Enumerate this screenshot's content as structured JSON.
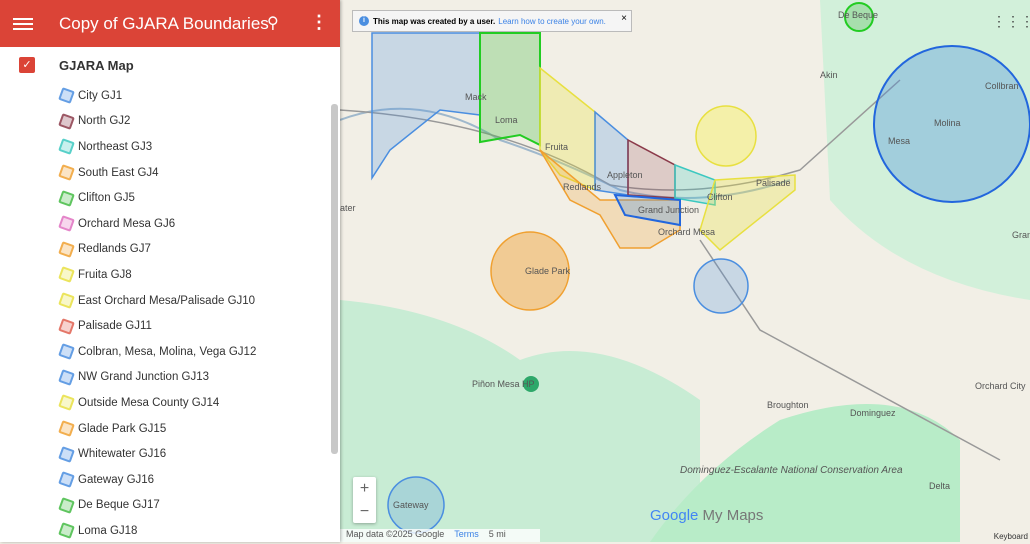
{
  "header": {
    "title": "Copy of GJARA Boundaries",
    "menu_icon": "hamburger-icon",
    "search_icon": "search-icon",
    "more_icon": "more-vert-icon"
  },
  "layer": {
    "name": "GJARA Map",
    "checked": true
  },
  "items": [
    {
      "label": "City GJ1",
      "color": "#4a8ee0"
    },
    {
      "label": "North GJ2",
      "color": "#8b3a4a"
    },
    {
      "label": "Northeast GJ3",
      "color": "#3cc8c0"
    },
    {
      "label": "South East GJ4",
      "color": "#f0a030"
    },
    {
      "label": "Clifton GJ5",
      "color": "#44bb44"
    },
    {
      "label": "Orchard Mesa GJ6",
      "color": "#e070c0"
    },
    {
      "label": "Redlands GJ7",
      "color": "#f0a030"
    },
    {
      "label": "Fruita GJ8",
      "color": "#e8e040"
    },
    {
      "label": "East Orchard Mesa/Palisade GJ10",
      "color": "#e8e040"
    },
    {
      "label": "Palisade GJ11",
      "color": "#e06050"
    },
    {
      "label": "Colbran, Mesa, Molina, Vega GJ12",
      "color": "#4a8ee0"
    },
    {
      "label": "NW Grand Junction GJ13",
      "color": "#4a8ee0"
    },
    {
      "label": "Outside Mesa County GJ14",
      "color": "#e8e040"
    },
    {
      "label": "Glade Park GJ15",
      "color": "#f0a030"
    },
    {
      "label": "Whitewater GJ16",
      "color": "#4a8ee0"
    },
    {
      "label": "Gateway GJ16",
      "color": "#4a8ee0"
    },
    {
      "label": "De Beque GJ17",
      "color": "#44bb44"
    },
    {
      "label": "Loma GJ18",
      "color": "#44bb44"
    }
  ],
  "notice": {
    "text": "This map was created by a user.",
    "link": "Learn how to create your own.",
    "close": "×"
  },
  "map": {
    "places": [
      "De Beque",
      "Akin",
      "Mack",
      "Loma",
      "Fruita",
      "Redlands",
      "Appleton",
      "Grand Junction",
      "Orchard Mesa",
      "Clifton",
      "Palisade",
      "Collbran",
      "Molina",
      "Mesa",
      "Grand Mesa",
      "Glade Park",
      "Piñon Mesa HP",
      "Broughton",
      "Dominguez",
      "Orchard City",
      "Delta",
      "Gateway",
      "Dominguez-Escalante National Conservation Area",
      "ater"
    ]
  },
  "zoom": {
    "in": "+",
    "out": "−"
  },
  "footer": {
    "attribution": "Map data ©2025 Google",
    "terms": "Terms",
    "scale": "5 mi",
    "logo_google": "Google",
    "logo_mymaps": "My Maps",
    "keyboard": "Keyboard"
  }
}
